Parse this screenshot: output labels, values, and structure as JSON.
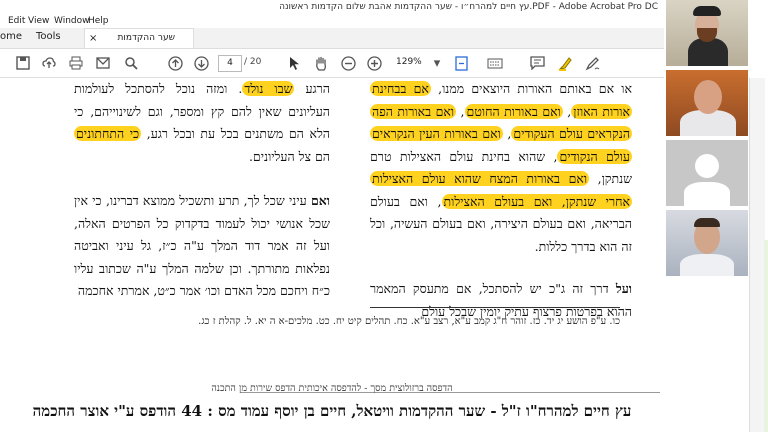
{
  "window": {
    "title": "עץ חיים למהרח״ו - שער ההקדמות אהבת שלום הקדמות ראשונה.PDF - Adobe Acrobat Pro DC"
  },
  "menu": [
    "Edit",
    "View",
    "Window",
    "Help"
  ],
  "tabs": {
    "home": "ome",
    "tools": "Tools",
    "document": "שער ההקדמות אהב..."
  },
  "toolbar": {
    "page_current": "4",
    "page_total": "/ 20",
    "zoom": "129%"
  },
  "document": {
    "right_column": [
      {
        "segments": [
          {
            "text": "או אם באותם האורות היוצאים ממנו, ",
            "hl": false
          },
          {
            "text": "אם בבחינת",
            "hl": true
          },
          {
            "text": " ",
            "hl": false
          },
          {
            "text": "אורות האוזן",
            "hl": true
          },
          {
            "text": ", ",
            "hl": false
          },
          {
            "text": "ואם באורות החוטם",
            "hl": true
          },
          {
            "text": ", ",
            "hl": false
          },
          {
            "text": "ואם באורות הפה",
            "hl": true
          },
          {
            "text": " ",
            "hl": false
          },
          {
            "text": "הנקראים עולם העקודים",
            "hl": true
          },
          {
            "text": ", ",
            "hl": false
          },
          {
            "text": "ואם באורות העין הנקראים",
            "hl": true
          },
          {
            "text": " ",
            "hl": false
          },
          {
            "text": "עולם הנקודים",
            "hl": true
          },
          {
            "text": ", שהוא בחינת עולם האצילות טרם שנתקן, ",
            "hl": false
          },
          {
            "text": "ואם באורות המצח שהוא עולם האצילות",
            "hl": true
          },
          {
            "text": " ",
            "hl": false
          },
          {
            "text": "אחרי שנתקן, ואם בעולם האצילות",
            "hl": true
          },
          {
            "text": ", ואם בעולם הבריאה, ואם בעולם היצירה, ואם בעולם העשיה, וכל זה הוא בדרך כללות.",
            "hl": false
          }
        ]
      },
      {
        "segments": [
          {
            "text": "ועל",
            "hl": false,
            "bold": true
          },
          {
            "text": " דרך זה ג\"כ יש להסתכל, אם מתעסק המאמר ההוא בפרטות פרצוף עתיק יומין שבכל עולם",
            "hl": false
          }
        ]
      }
    ],
    "left_column": [
      {
        "segments": [
          {
            "text": "הרגע ",
            "hl": false
          },
          {
            "text": "שבו נולד",
            "hl": true
          },
          {
            "text": ". ומזה נוכל להסתכל לעולמות העליונים שאין להם קץ ומספר, וגם לשינוייהם, כי הלא הם משתנים בכל עת ובכל רגע, ",
            "hl": false
          },
          {
            "text": "כי התחתונים",
            "hl": true
          },
          {
            "text": " הם צל העליונים.",
            "hl": false
          }
        ]
      },
      {
        "segments": [
          {
            "text": "ואם",
            "hl": false,
            "bold": true
          },
          {
            "text": " עיני שכל לך, תרע ותשכיל ממוצא דברינו, כי אין שכל אנושי יכול לעמוד בדקדוק כל הפרטים האלה, ועל זה אמר דוד המלך ע\"ה כ״ז, גל עיני ואביטה נפלאות מתורתך. וכן שלמה המלך ע\"ה שכתוב עליו כ״ח ויחכם מכל האדם וכו׳ אמר כ״ט, אמרתי אחכמה",
            "hl": false
          }
        ]
      }
    ],
    "footnotes": "כו. ע\"פ הושע יג יד.   כז. זוהר ח\"ג קמב ע\"א, רצב ע\"א.   כח. תהלים קיט יח.   כט. מלכים-א ה יא.   ל. קהלת ז כג.",
    "print_notice": "הדפסה ברזולוצית מסך - להדפסה איכותית הדפס שירות מן התכנה",
    "banner": "עץ חיים למהרח\"ו ז\"ל - שער ההקדמות וויטאל, חיים בן יוסף עמוד מס : 44 הודפס ע\"י אוצר החכמה"
  },
  "participants": [
    "participant-1",
    "participant-2",
    "participant-3",
    "participant-4"
  ],
  "colors": {
    "highlight": "#ffd21f",
    "annotation_accent": "#f2c400"
  }
}
